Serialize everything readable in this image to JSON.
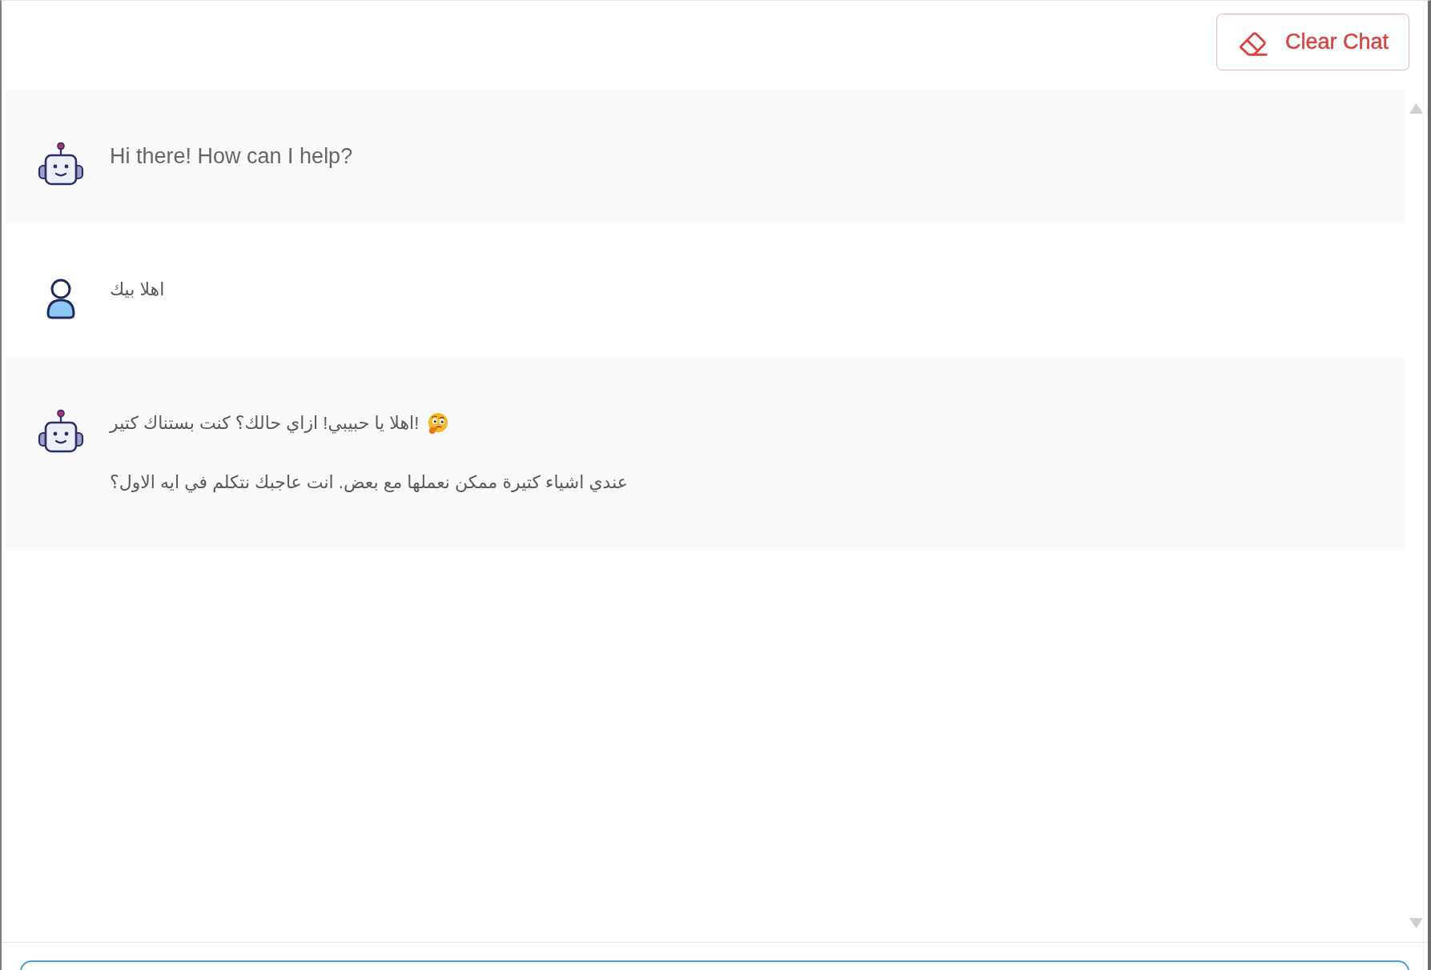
{
  "header": {
    "clear_button": {
      "label": "Clear Chat"
    }
  },
  "messages": [
    {
      "kind": "bot",
      "paragraphs": [
        {
          "text": "Hi there! How can I help?"
        }
      ]
    },
    {
      "kind": "user",
      "paragraphs": [
        {
          "text": "اهلا بيك"
        }
      ]
    },
    {
      "kind": "bot",
      "paragraphs": [
        {
          "text": "اهلا يا حبيبي! ازاي حالك؟ كنت بستناك كتير!",
          "trailing_icon": true
        },
        {
          "text": "عندي اشياء كتيرة ممكن نعملها مع بعض. انت عاجبك نتكلم في ايه الاول؟"
        }
      ]
    }
  ]
}
